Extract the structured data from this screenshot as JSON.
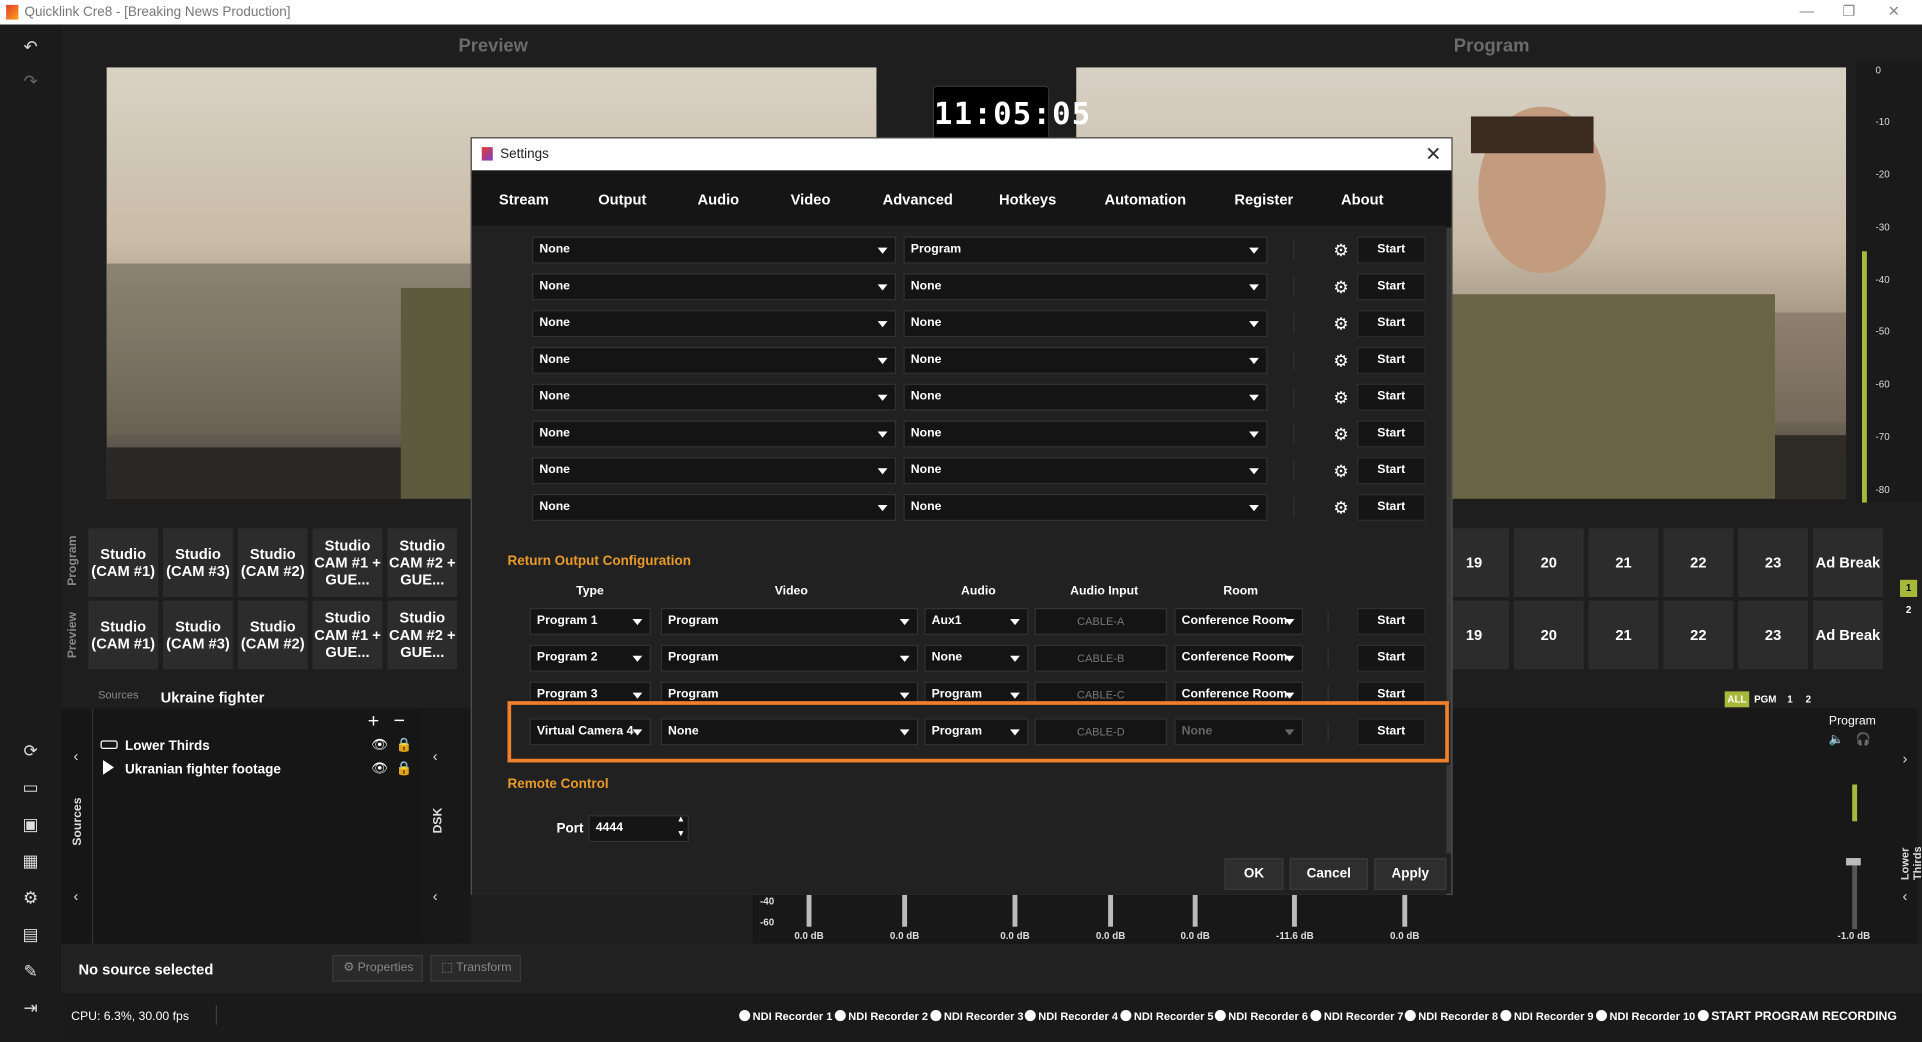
{
  "window": {
    "title": "Quicklink Cre8 - [Breaking News Production]"
  },
  "preview_label": "Preview",
  "program_label": "Program",
  "clock": "11:05:05",
  "vu_ticks": [
    "0",
    "-10",
    "-20",
    "-30",
    "-40",
    "-50",
    "-60",
    "-70",
    "-80"
  ],
  "scene_rows": {
    "program_label": "Program",
    "preview_label": "Preview",
    "left_scenes": [
      "Studio (CAM #1)",
      "Studio (CAM #3)",
      "Studio (CAM #2)",
      "Studio CAM #1 + GUE...",
      "Studio CAM #2 + GUE..."
    ],
    "right_scenes": [
      "19",
      "20",
      "21",
      "22",
      "23",
      "Ad Break"
    ],
    "side_numbers": [
      "1",
      "2"
    ]
  },
  "sources": {
    "header_label": "Sources",
    "header_value": "Ukraine fighter",
    "vertical_label": "Sources",
    "dsk_label": "DSK",
    "items": [
      "Lower Thirds",
      "Ukranian fighter footage"
    ]
  },
  "bottom": {
    "no_source": "No source selected",
    "properties": "Properties",
    "transform": "Transform",
    "cpu": "CPU: 6.3%, 30.00 fps"
  },
  "recorders": [
    "NDI Recorder 1",
    "NDI Recorder 2",
    "NDI Recorder 3",
    "NDI Recorder 4",
    "NDI Recorder 5",
    "NDI Recorder 6",
    "NDI Recorder 7",
    "NDI Recorder 8",
    "NDI Recorder 9",
    "NDI Recorder 10"
  ],
  "start_program_recording": "START PROGRAM RECORDING",
  "mixer": {
    "filters": [
      "ALL",
      "PGM",
      "1",
      "2"
    ],
    "program_label": "Program",
    "lower_thirds_label": "Lower Thirds Control",
    "db_values": [
      "0.0 dB",
      "0.0 dB",
      "0.0 dB",
      "0.0 dB",
      "0.0 dB",
      "-11.6 dB",
      "0.0 dB"
    ],
    "master_db": "-1.0 dB",
    "scale": [
      "-40",
      "-60"
    ]
  },
  "dialog": {
    "title": "Settings",
    "tabs": [
      "Stream",
      "Output",
      "Audio",
      "Video",
      "Advanced",
      "Hotkeys",
      "Automation",
      "Register",
      "About"
    ],
    "active_tab": "Advanced",
    "output_rows": [
      {
        "a": "None",
        "b": "Program",
        "btn": "Start"
      },
      {
        "a": "None",
        "b": "None",
        "btn": "Start"
      },
      {
        "a": "None",
        "b": "None",
        "btn": "Start"
      },
      {
        "a": "None",
        "b": "None",
        "btn": "Start"
      },
      {
        "a": "None",
        "b": "None",
        "btn": "Start"
      },
      {
        "a": "None",
        "b": "None",
        "btn": "Start"
      },
      {
        "a": "None",
        "b": "None",
        "btn": "Start"
      },
      {
        "a": "None",
        "b": "None",
        "btn": "Start"
      }
    ],
    "return_section": "Return Output Configuration",
    "columns": [
      "Type",
      "Video",
      "Audio",
      "Audio Input",
      "Room"
    ],
    "return_rows": [
      {
        "type": "Program 1",
        "video": "Program",
        "audio": "Aux1",
        "input": "CABLE-A",
        "room": "Conference Room",
        "btn": "Start"
      },
      {
        "type": "Program 2",
        "video": "Program",
        "audio": "None",
        "input": "CABLE-B",
        "room": "Conference Room",
        "btn": "Start"
      },
      {
        "type": "Program 3",
        "video": "Program",
        "audio": "Program",
        "input": "CABLE-C",
        "room": "Conference Room",
        "btn": "Start"
      },
      {
        "type": "Virtual Camera 4",
        "video": "None",
        "audio": "Program",
        "input": "CABLE-D",
        "room": "None",
        "btn": "Start"
      }
    ],
    "remote_section": "Remote Control",
    "port_label": "Port",
    "port_value": "4444",
    "ok": "OK",
    "cancel": "Cancel",
    "apply": "Apply"
  },
  "colors": {
    "accent_orange": "#f0802a",
    "section_orange": "#e89a2a",
    "tab_underline": "#c9a227",
    "vu_green": "#a7b93a"
  }
}
